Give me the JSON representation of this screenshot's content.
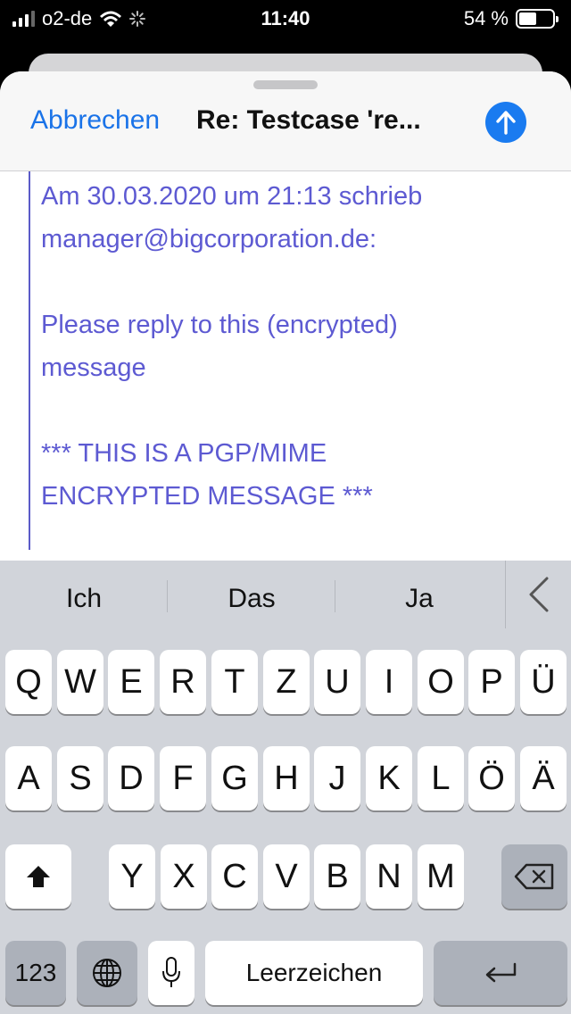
{
  "status_bar": {
    "carrier": "o2-de",
    "time": "11:40",
    "battery": "54 %",
    "battery_level": 0.54
  },
  "compose": {
    "cancel_label": "Abbrechen",
    "subject": "Re: Testcase 're...",
    "send_icon": "arrow-up-circle-icon"
  },
  "body": {
    "quote_header_1": "Am 30.03.2020 um 21:13 schrieb",
    "quote_header_2": "manager@bigcorporation.de:",
    "line_1": "Please reply to this (encrypted)",
    "line_2": "message",
    "line_3": "*** THIS IS A PGP/MIME",
    "line_4": "ENCRYPTED MESSAGE ***"
  },
  "keyboard": {
    "suggestions": [
      "Ich",
      "Das",
      "Ja"
    ],
    "row1": [
      "Q",
      "W",
      "E",
      "R",
      "T",
      "Z",
      "U",
      "I",
      "O",
      "P",
      "Ü"
    ],
    "row2": [
      "A",
      "S",
      "D",
      "F",
      "G",
      "H",
      "J",
      "K",
      "L",
      "Ö",
      "Ä"
    ],
    "row3": [
      "Y",
      "X",
      "C",
      "V",
      "B",
      "N",
      "M"
    ],
    "numbers_label": "123",
    "space_label": "Leerzeichen",
    "colors": {
      "background": "#d1d4da",
      "key": "#ffffff",
      "dark_key": "#acb1ba"
    }
  }
}
